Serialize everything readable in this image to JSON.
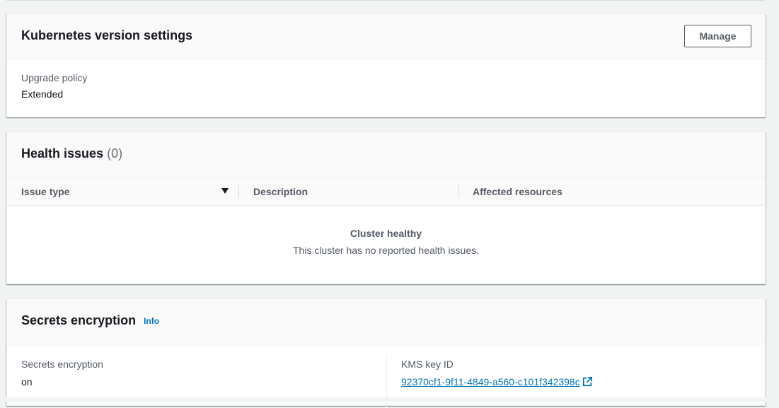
{
  "kubernetes_version": {
    "title": "Kubernetes version settings",
    "manage_button": "Manage",
    "upgrade_policy_label": "Upgrade policy",
    "upgrade_policy_value": "Extended"
  },
  "health_issues": {
    "title": "Health issues",
    "count": "(0)",
    "columns": [
      "Issue type",
      "Description",
      "Affected resources"
    ],
    "empty_title": "Cluster healthy",
    "empty_description": "This cluster has no reported health issues."
  },
  "secrets_encryption": {
    "title": "Secrets encryption",
    "info_link": "Info",
    "encryption_label": "Secrets encryption",
    "encryption_value": "on",
    "kms_label": "KMS key ID",
    "kms_value": "92370cf1-9f11-4849-a560-c101f342398c"
  },
  "icons": {
    "sort": "caret-down-icon",
    "external": "external-link-icon"
  },
  "colors": {
    "link": "#0073bb",
    "background": "#f2f3f3",
    "panel_header": "#fafafa"
  }
}
